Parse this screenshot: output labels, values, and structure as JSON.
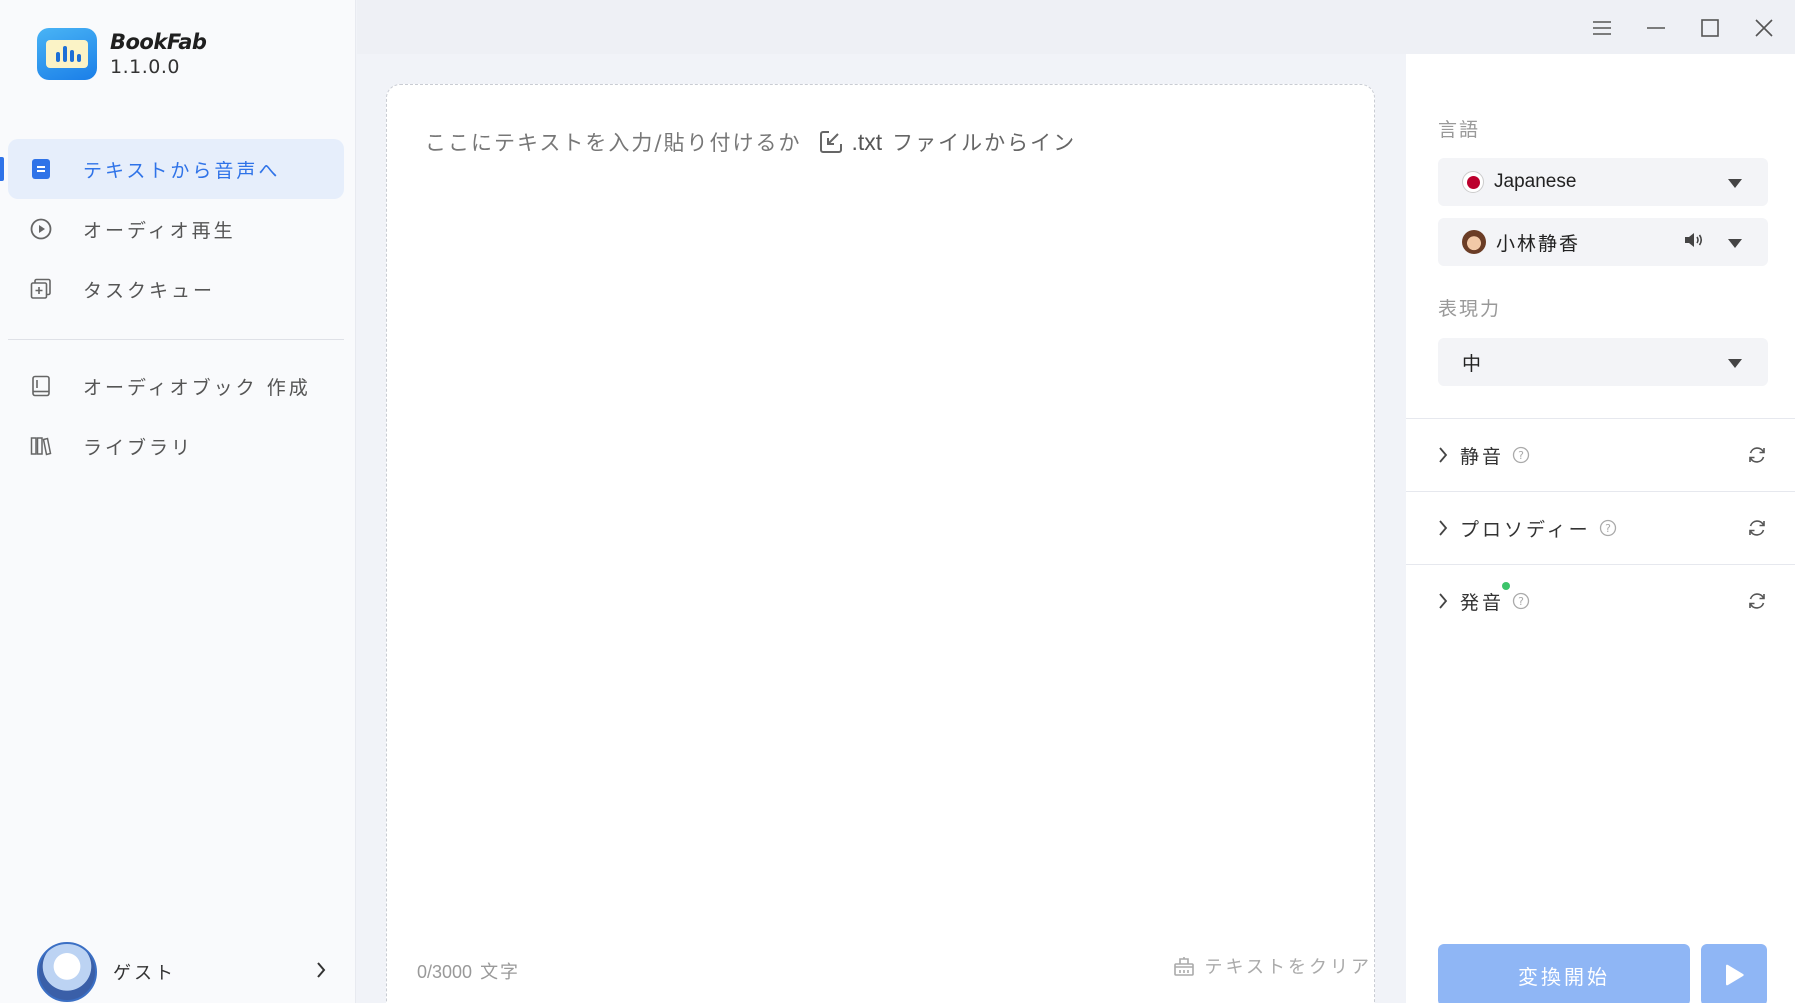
{
  "app": {
    "name": "BookFab",
    "version": "1.1.0.0"
  },
  "sidebar": {
    "items": [
      {
        "label": "テキストから音声へ",
        "icon": "document-icon",
        "active": true
      },
      {
        "label": "オーディオ再生",
        "icon": "play-circle-icon"
      },
      {
        "label": "タスクキュー",
        "icon": "task-queue-icon"
      },
      {
        "label": "オーディオブック 作成",
        "icon": "book-icon"
      },
      {
        "label": "ライブラリ",
        "icon": "library-icon"
      }
    ],
    "user": {
      "name": "ゲスト"
    }
  },
  "editor": {
    "placeholder_prefix": "ここにテキストを入力/貼り付けるか",
    "import_ext": ".txt",
    "import_suffix": "ファイルからイン",
    "char_count": "0/3000",
    "char_unit": "文字",
    "clear_label": "テキストをクリア"
  },
  "settings": {
    "language_label": "言語",
    "language_value": "Japanese",
    "voice_value": "小林静香",
    "expressiveness_label": "表現力",
    "expressiveness_value": "中",
    "sections": [
      {
        "title": "静音",
        "has_dot": false
      },
      {
        "title": "プロソディー",
        "has_dot": false
      },
      {
        "title": "発音",
        "has_dot": true
      }
    ],
    "convert_label": "変換開始"
  },
  "colors": {
    "accent": "#2f73e8",
    "button": "#8fb6f5",
    "active_bg": "#e6eefb",
    "dot": "#3cc46a"
  }
}
